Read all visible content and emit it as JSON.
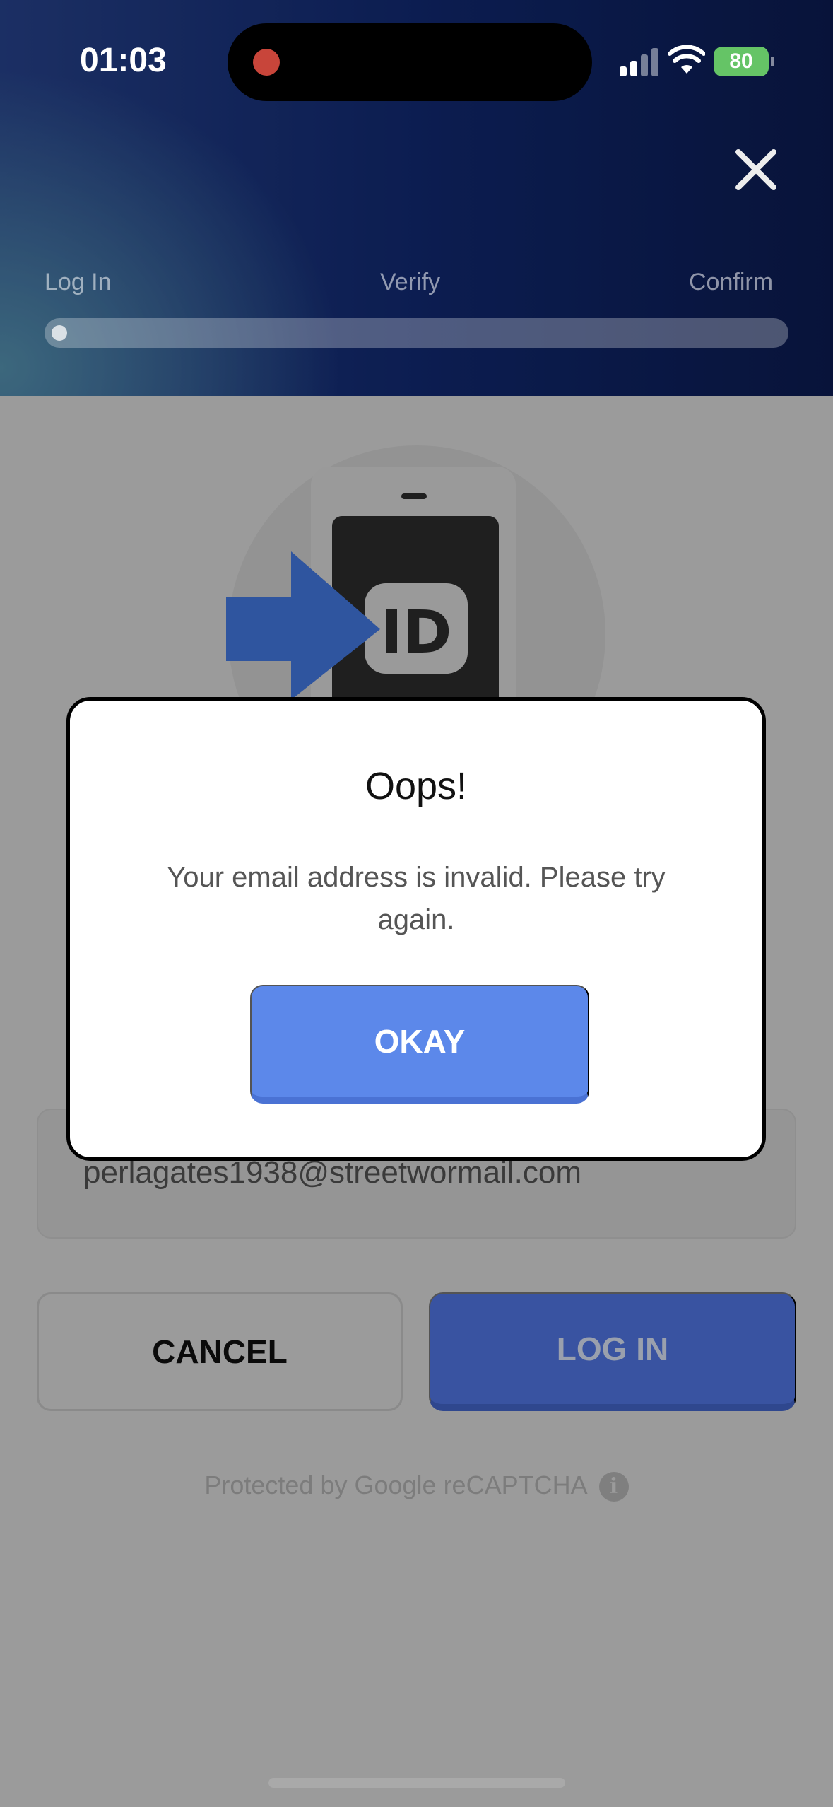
{
  "status_bar": {
    "time": "01:03",
    "battery": "80"
  },
  "progress": {
    "steps": [
      "Log In",
      "Verify",
      "Confirm"
    ],
    "current_step": 0,
    "fraction_complete": 0.0
  },
  "illustration": {
    "badge_text": "ID"
  },
  "form": {
    "email_value": "perlagates1938@streetwormail.com"
  },
  "buttons": {
    "cancel_label": "CANCEL",
    "login_label": "LOG IN"
  },
  "footer": {
    "recaptcha_text": "Protected by Google reCAPTCHA",
    "info_glyph": "i"
  },
  "modal": {
    "title": "Oops!",
    "message": "Your email address is invalid. Please try again.",
    "ok_label": "OKAY"
  },
  "colors": {
    "header_dark": "#0f2463",
    "primary_button": "#5c88ea",
    "login_button_dimmed": "#3953a1",
    "arrow_blue": "#2f559f",
    "battery_green": "#65c466",
    "recording_dot": "#c8453a"
  },
  "icons": [
    "close-icon",
    "cellular-signal-icon",
    "wifi-icon",
    "battery-icon",
    "id-phone-illustration",
    "arrow-illustration",
    "info-icon"
  ]
}
